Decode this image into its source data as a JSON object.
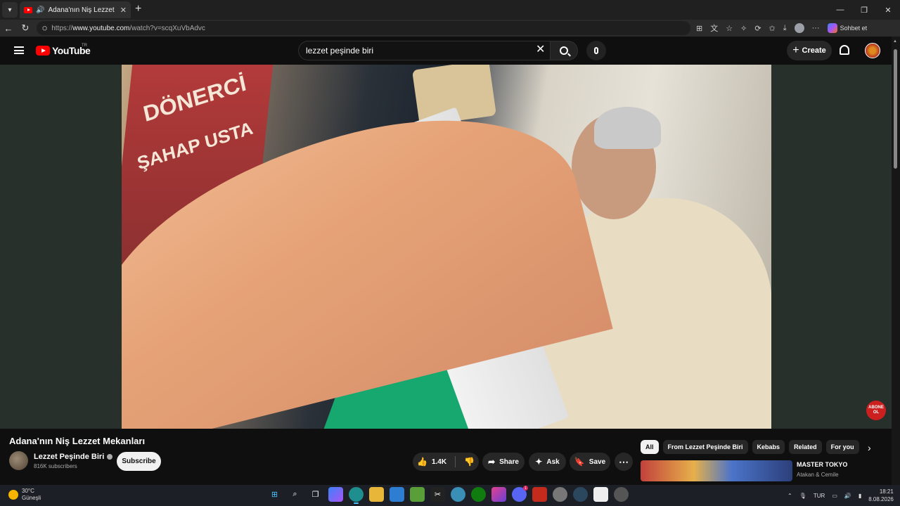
{
  "browser": {
    "tab_title": "Adana'nın Niş Lezzet Mekanları - YouTube",
    "url_prefix": "https://",
    "url_host": "www.youtube.com",
    "url_path": "/watch?v=scqXuVbAdvc",
    "copilot_label": "Sohbet et"
  },
  "header": {
    "logo_text": "YouTube",
    "region": "TR",
    "search_value": "lezzet peşinde biri",
    "create_label": "Create"
  },
  "video": {
    "sign_text_1": "DÖNERCİ",
    "sign_text_2": "ŞAHAP USTA",
    "overlay_badge": "ABONE OL",
    "title": "Adana'nın Niş Lezzet Mekanları",
    "channel_name": "Lezzet Peşinde Biri",
    "subscribers": "816K subscribers",
    "subscribe_label": "Subscribe",
    "like_count": "1.4K",
    "share_label": "Share",
    "ask_label": "Ask",
    "save_label": "Save"
  },
  "chips": [
    "All",
    "From Lezzet Peşinde Biri",
    "Kebabs",
    "Related",
    "For you"
  ],
  "recommendation": {
    "title": "MASTER TOKYO",
    "channel": "Atakan & Cemile"
  },
  "taskbar": {
    "temperature": "30°C",
    "condition": "Güneşli",
    "language": "TUR",
    "time": "18:21",
    "date": "8.08.2026",
    "discord_badge": "1"
  },
  "colors": {
    "accent_red": "#ff0000",
    "background": "#0f0f0f",
    "pill": "#272727"
  }
}
